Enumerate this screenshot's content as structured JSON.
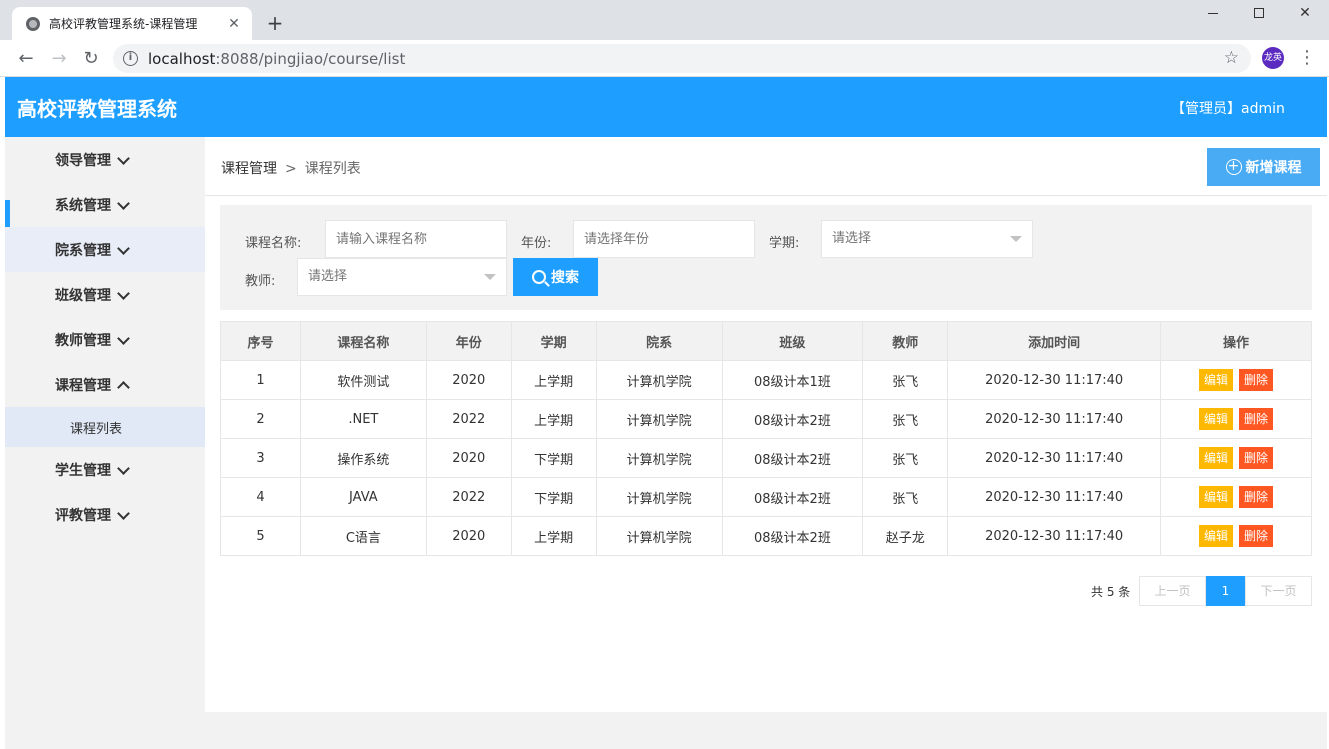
{
  "browser": {
    "tab_title": "高校评教管理系统-课程管理",
    "tab_close": "✕",
    "new_tab": "+",
    "url_host": "localhost",
    "url_rest": ":8088/pingjiao/course/list",
    "avatar_text": "龙英",
    "back": "←",
    "forward": "→",
    "reload": "↻",
    "star": "☆",
    "menu": "⋮",
    "win_close": "✕"
  },
  "header": {
    "title": "高校评教管理系统",
    "user": "【管理员】admin"
  },
  "sidebar": {
    "items": [
      {
        "label": "领导管理"
      },
      {
        "label": "系统管理"
      },
      {
        "label": "院系管理"
      },
      {
        "label": "班级管理"
      },
      {
        "label": "教师管理"
      },
      {
        "label": "课程管理"
      },
      {
        "label": "学生管理"
      },
      {
        "label": "评教管理"
      }
    ],
    "sub_course_list": "课程列表"
  },
  "breadcrumb": {
    "parent": "课程管理",
    "sep": ">",
    "current": "课程列表"
  },
  "add_button": "新增课程",
  "search": {
    "course_label": "课程名称:",
    "course_placeholder": "请输入课程名称",
    "year_label": "年份:",
    "year_placeholder": "请选择年份",
    "term_label": "学期:",
    "term_value": "请选择",
    "teacher_label": "教师:",
    "teacher_value": "请选择",
    "button": "搜索"
  },
  "table": {
    "headers": [
      "序号",
      "课程名称",
      "年份",
      "学期",
      "院系",
      "班级",
      "教师",
      "添加时间",
      "操作"
    ],
    "rows": [
      [
        "1",
        "软件测试",
        "2020",
        "上学期",
        "计算机学院",
        "08级计本1班",
        "张飞",
        "2020-12-30 11:17:40"
      ],
      [
        "2",
        ".NET",
        "2022",
        "上学期",
        "计算机学院",
        "08级计本2班",
        "张飞",
        "2020-12-30 11:17:40"
      ],
      [
        "3",
        "操作系统",
        "2020",
        "下学期",
        "计算机学院",
        "08级计本2班",
        "张飞",
        "2020-12-30 11:17:40"
      ],
      [
        "4",
        "JAVA",
        "2022",
        "下学期",
        "计算机学院",
        "08级计本2班",
        "张飞",
        "2020-12-30 11:17:40"
      ],
      [
        "5",
        "C语言",
        "2020",
        "上学期",
        "计算机学院",
        "08级计本2班",
        "赵子龙",
        "2020-12-30 11:17:40"
      ]
    ],
    "edit_label": "编辑",
    "delete_label": "删除"
  },
  "pager": {
    "total": "共 5 条",
    "prev": "上一页",
    "current": "1",
    "next": "下一页"
  },
  "colors": {
    "primary": "#1e9fff",
    "edit": "#ffb800",
    "delete": "#ff5722"
  }
}
